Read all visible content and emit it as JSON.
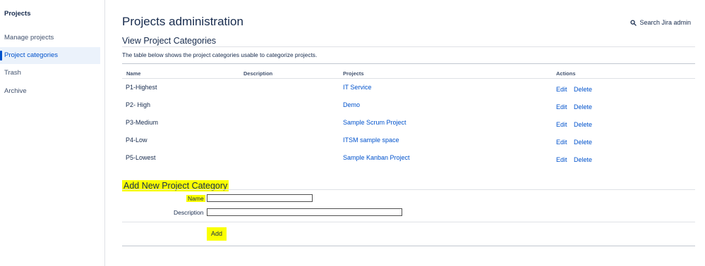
{
  "sidebar": {
    "title": "Projects",
    "items": [
      {
        "label": "Manage projects"
      },
      {
        "label": "Project categories"
      },
      {
        "label": "Trash"
      },
      {
        "label": "Archive"
      }
    ]
  },
  "header": {
    "title": "Projects administration",
    "search_label": "Search Jira admin"
  },
  "view_section": {
    "title": "View Project Categories",
    "description": "The table below shows the project categories usable to categorize projects.",
    "columns": [
      "Name",
      "Description",
      "Projects",
      "Actions"
    ],
    "rows": [
      {
        "name": "P1-Highest",
        "description": "",
        "projects": "IT Service",
        "edit": "Edit",
        "delete": "Delete"
      },
      {
        "name": "P2- High",
        "description": "",
        "projects": "Demo",
        "edit": "Edit",
        "delete": "Delete"
      },
      {
        "name": "P3-Medium",
        "description": "",
        "projects": "Sample Scrum Project",
        "edit": "Edit",
        "delete": "Delete"
      },
      {
        "name": "P4-Low",
        "description": "",
        "projects": "ITSM sample space",
        "edit": "Edit",
        "delete": "Delete"
      },
      {
        "name": "P5-Lowest",
        "description": "",
        "projects": "Sample Kanban Project",
        "edit": "Edit",
        "delete": "Delete"
      }
    ]
  },
  "add_section": {
    "title": "Add New Project Category",
    "name_label": "Name",
    "name_value": "",
    "description_label": "Description",
    "description_value": "",
    "add_button": "Add"
  },
  "colors": {
    "link": "#0052cc",
    "highlight": "#faff00",
    "active_nav_bg": "#ebf2fb"
  }
}
